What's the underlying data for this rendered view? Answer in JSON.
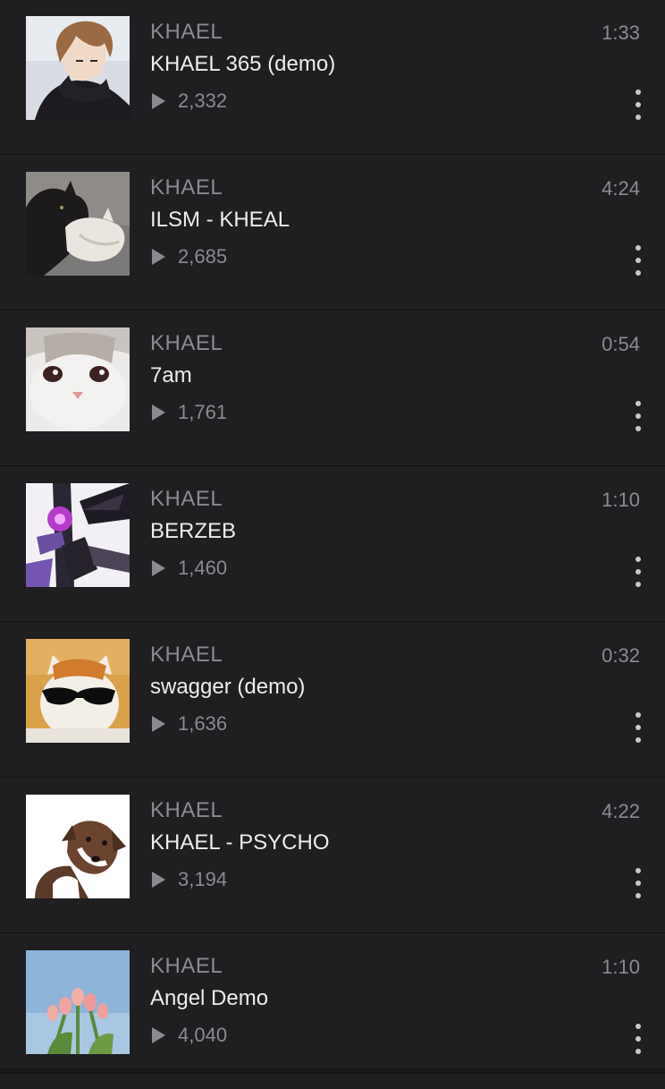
{
  "tracks": [
    {
      "artist": "KHAEL",
      "title": "KHAEL 365 (demo)",
      "plays": "2,332",
      "duration": "1:33",
      "artwork": "anime-boy-artwork"
    },
    {
      "artist": "KHAEL",
      "title": "ILSM - KHEAL",
      "plays": "2,685",
      "duration": "4:24",
      "artwork": "cats-cuddling-artwork"
    },
    {
      "artist": "KHAEL",
      "title": "7am",
      "plays": "1,761",
      "duration": "0:54",
      "artwork": "white-cat-artwork"
    },
    {
      "artist": "KHAEL",
      "title": "BERZEB",
      "plays": "1,460",
      "duration": "1:10",
      "artwork": "dark-winged-figure-artwork"
    },
    {
      "artist": "KHAEL",
      "title": "swagger (demo)",
      "plays": "1,636",
      "duration": "0:32",
      "artwork": "cat-sunglasses-artwork"
    },
    {
      "artist": "KHAEL",
      "title": "KHAEL - PSYCHO",
      "plays": "3,194",
      "duration": "4:22",
      "artwork": "dog-head-tilt-artwork"
    },
    {
      "artist": "KHAEL",
      "title": "Angel Demo",
      "plays": "4,040",
      "duration": "1:10",
      "artwork": "tulips-sky-artwork"
    }
  ],
  "icons": {
    "play": "play-icon",
    "more": "more-options-icon"
  },
  "colors": {
    "background": "#1f1e21",
    "secondary_text": "#8b8a8e",
    "primary_text": "#ededed"
  }
}
